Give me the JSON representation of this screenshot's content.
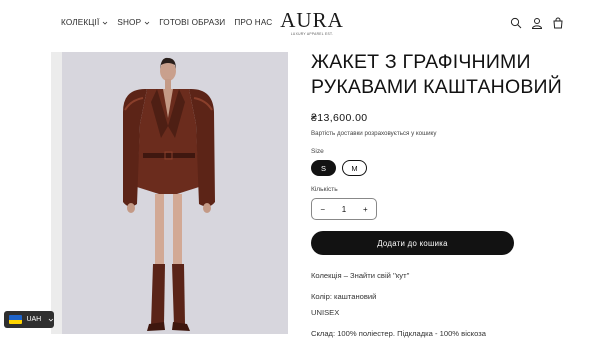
{
  "nav": {
    "items": [
      {
        "label": "КОЛЕКЦІЇ",
        "has_dropdown": true
      },
      {
        "label": "SHOP",
        "has_dropdown": true
      },
      {
        "label": "ГОТОВІ ОБРАЗИ",
        "has_dropdown": false
      },
      {
        "label": "ПРО НАС",
        "has_dropdown": false
      }
    ]
  },
  "logo": {
    "main": "AURA",
    "sub": "LUXURY APPAREL EST."
  },
  "header_icons": [
    "search-icon",
    "account-icon",
    "cart-icon"
  ],
  "product": {
    "title": "ЖАКЕТ З ГРАФІЧНИМИ РУКАВАМИ КАШТАНОВИЙ",
    "price": "₴13,600.00",
    "shipping_note": "Вартість доставки розраховується у кошику",
    "size_label": "Size",
    "sizes": [
      {
        "label": "S",
        "selected": true
      },
      {
        "label": "M",
        "selected": false
      }
    ],
    "quantity_label": "Кількість",
    "quantity": "1",
    "minus": "−",
    "plus": "+",
    "add_to_cart": "Додати до кошика",
    "description": {
      "collection": "Колекція – Знайти свій ''кут''",
      "color": "Колір: каштановий",
      "gender": "UNISEX",
      "composition": "Склад: 100% поліестер. Підкладка - 100% віскоза"
    }
  },
  "currency": {
    "code": "UAH",
    "flag": "ukraine-flag-icon"
  },
  "colors": {
    "accent": "#121212",
    "jacket": "#6b2c1d",
    "image_bg": "#d7d6dd",
    "flag_blue": "#1e63c9",
    "flag_yellow": "#ffd500"
  }
}
